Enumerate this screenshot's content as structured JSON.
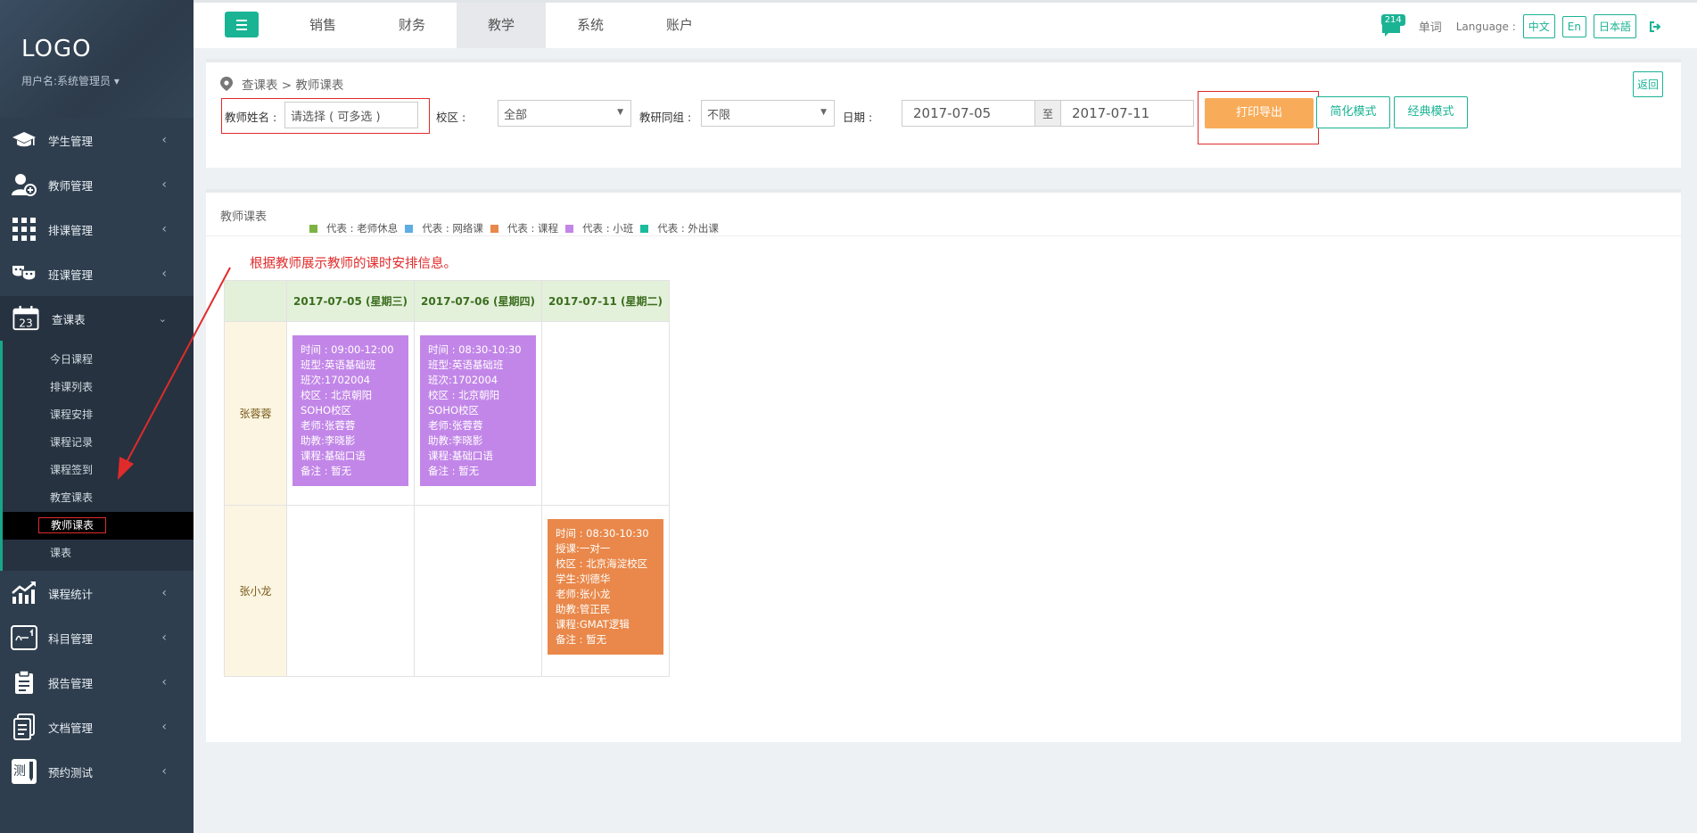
{
  "sidebar": {
    "logo": "LOGO",
    "user": "用户名:系统管理员",
    "items": [
      {
        "label": "学生管理"
      },
      {
        "label": "教师管理"
      },
      {
        "label": "排课管理"
      },
      {
        "label": "班课管理"
      },
      {
        "label": "查课表",
        "calendar_day": "23"
      },
      {
        "label": "课程统计"
      },
      {
        "label": "科目管理"
      },
      {
        "label": "报告管理"
      },
      {
        "label": "文档管理"
      },
      {
        "label": "预约测试",
        "icon_char": "测"
      }
    ],
    "sub_items": [
      "今日课程",
      "排课列表",
      "课程安排",
      "课程记录",
      "课程签到",
      "教室课表",
      "教师课表",
      "课表"
    ]
  },
  "topbar": {
    "tabs": [
      "销售",
      "财务",
      "教学",
      "系统",
      "账户"
    ],
    "active_tab": "教学",
    "badge": "214",
    "word_label": "单词",
    "language_label": "Language :",
    "langs": [
      "中文",
      "En",
      "日本語"
    ]
  },
  "breadcrumb": "查课表 > 教师课表",
  "back_label": "返回",
  "filters": {
    "teacher_label": "教师姓名 :",
    "teacher_placeholder": "请选择 ( 可多选 )",
    "campus_label": "校区 :",
    "campus_value": "全部",
    "group_label": "教研同组 :",
    "group_value": "不限",
    "date_label": "日期 :",
    "date_from": "2017-07-05",
    "date_sep": "至",
    "date_to": "2017-07-11",
    "print_label": "打印导出",
    "simple_label": "简化模式",
    "classic_label": "经典模式"
  },
  "schedule": {
    "title": "教师课表",
    "legend": [
      {
        "label": "代表 : 老师休息",
        "color": "#7cb342"
      },
      {
        "label": "代表 : 网络课",
        "color": "#5dade2"
      },
      {
        "label": "代表 : 课程",
        "color": "#e9884a"
      },
      {
        "label": "代表 : 小班",
        "color": "#c286e8"
      },
      {
        "label": "代表 : 外出课",
        "color": "#1abc9c"
      }
    ],
    "annotation": "根据教师展示教师的课时安排信息。",
    "columns": [
      "2017-07-05 (星期三)",
      "2017-07-06 (星期四)",
      "2017-07-11 (星期二)"
    ],
    "teachers": [
      {
        "name": "张蓉蓉",
        "cells": [
          [
            "时间 : 09:00-12:00",
            "班型:英语基础班",
            "班次:1702004",
            "校区 : 北京朝阳",
            "SOHO校区",
            "老师:张蓉蓉",
            "助教:李晓影",
            "课程:基础口语",
            "备注 : 暂无"
          ],
          [
            "时间 : 08:30-10:30",
            "班型:英语基础班",
            "班次:1702004",
            "校区 : 北京朝阳",
            "SOHO校区",
            "老师:张蓉蓉",
            "助教:李晓影",
            "课程:基础口语",
            "备注 : 暂无"
          ],
          []
        ]
      },
      {
        "name": "张小龙",
        "cells": [
          [],
          [],
          [
            "时间 : 08:30-10:30",
            "授课:一对一",
            "校区 : 北京海淀校区",
            "学生:刘德华",
            "老师:张小龙",
            "助教:管正民",
            "课程:GMAT逻辑",
            "备注 : 暂无"
          ]
        ]
      }
    ]
  }
}
